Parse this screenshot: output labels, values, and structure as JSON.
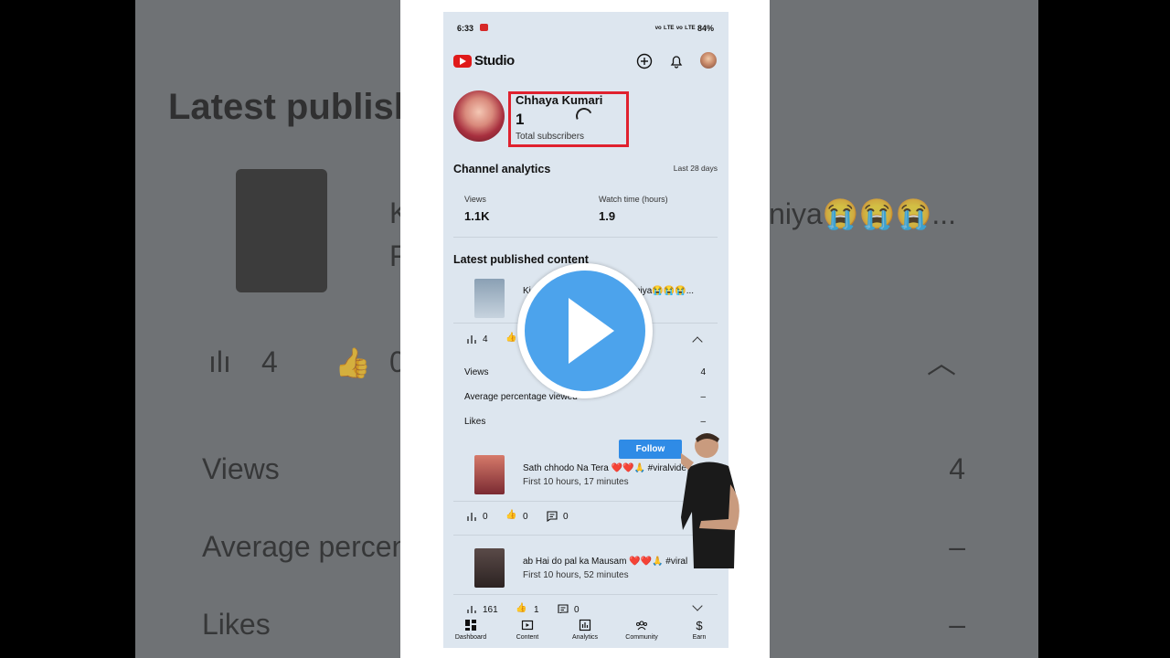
{
  "background": {
    "heading": "Latest publish",
    "row1_left": "Views",
    "row1_right": "4",
    "row2_left": "Average percen",
    "row2_right": "–",
    "row3_left": "Likes",
    "row3_right": "–",
    "title_fragment": "K",
    "title_fragment_right": "niya😭😭😭...",
    "subtitle_fragment": "F",
    "views_count": "4",
    "likes_count": "0"
  },
  "status_bar": {
    "time": "6:33",
    "right": "ᵛᵒ ᴸᵀᴱ ᵛᵒ ᴸᵀᴱ 84%"
  },
  "header": {
    "brand": "Studio"
  },
  "channel": {
    "name": "Chhaya Kumari",
    "subscribers": "1",
    "subscribers_label": "Total subscribers"
  },
  "analytics": {
    "title": "Channel analytics",
    "period": "Last 28 days",
    "views_label": "Views",
    "views_value": "1.1K",
    "watch_label": "Watch time (hours)",
    "watch_value": "1.9"
  },
  "latest": {
    "title": "Latest published content",
    "videos": [
      {
        "title_left": "Ki",
        "title_right": "niya😭😭😭...",
        "views": "4",
        "likes": "",
        "detail_rows": [
          {
            "label": "Views",
            "value": "4"
          },
          {
            "label": "Average percentage viewed",
            "value": "–"
          },
          {
            "label": "Likes",
            "value": "–"
          }
        ]
      },
      {
        "title": "Sath chhodo Na Tera ❤️❤️🙏 #viralvide",
        "subtitle": "First 10 hours, 17 minutes",
        "views": "0",
        "likes": "0",
        "comments": "0"
      },
      {
        "title": "ab Hai do pal ka Mausam ❤️❤️🙏 #viral",
        "subtitle": "First 10 hours, 52 minutes",
        "views": "161",
        "likes": "1",
        "comments": "0"
      }
    ]
  },
  "nav": {
    "items": [
      "Dashboard",
      "Content",
      "Analytics",
      "Community",
      "Earn"
    ]
  },
  "overlay": {
    "follow_label": "Follow"
  },
  "colors": {
    "accent_red": "#e0212e",
    "play_blue": "#4ca3ec",
    "follow_blue": "#2f8be6",
    "phone_bg": "#dde6ef"
  }
}
